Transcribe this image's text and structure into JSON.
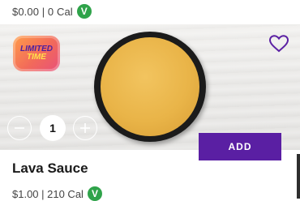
{
  "prev_item": {
    "price_cal": "$0.00 | 0 Cal",
    "veg_badge": "V"
  },
  "item": {
    "promo_badge": {
      "line1": "LIMITED",
      "line2": "TIME"
    },
    "name": "Lava Sauce",
    "price_cal": "$1.00 | 210 Cal",
    "veg_badge": "V",
    "quantity": "1",
    "add_label": "ADD",
    "favorite_icon": "heart-outline-icon",
    "minus_icon": "minus-circle-icon",
    "plus_icon": "plus-circle-icon"
  },
  "colors": {
    "accent": "#5a1fa3",
    "veg_green": "#2fa34a",
    "sauce": "#e9b448"
  }
}
